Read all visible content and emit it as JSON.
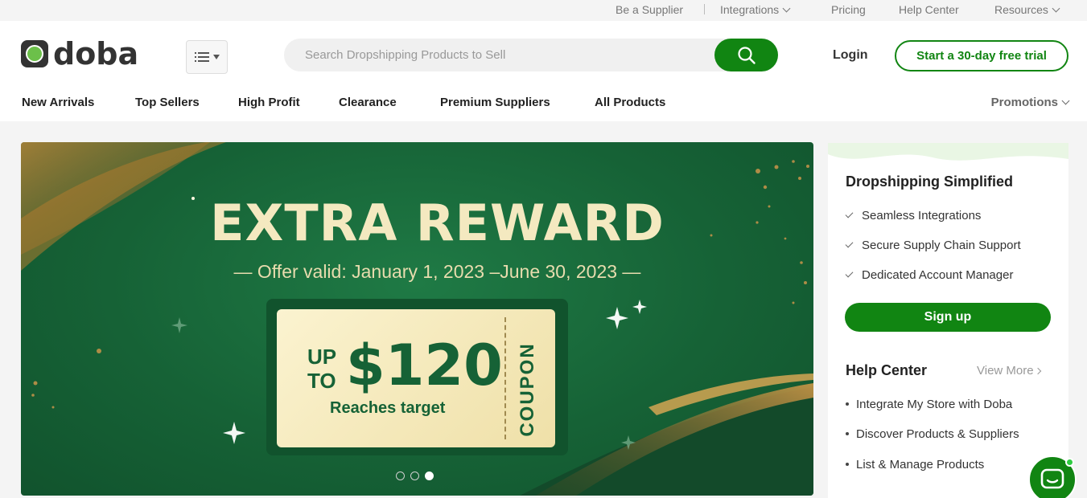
{
  "utility_bar": {
    "supplier": "Be a Supplier",
    "integrations": "Integrations",
    "pricing": "Pricing",
    "help_center": "Help Center",
    "resources": "Resources"
  },
  "header": {
    "logo_text": "doba",
    "search_placeholder": "Search Dropshipping Products to Sell",
    "login": "Login",
    "trial": "Start a 30-day free trial"
  },
  "nav": {
    "items": [
      "New Arrivals",
      "Top Sellers",
      "High Profit",
      "Clearance",
      "Premium Suppliers",
      "All Products"
    ],
    "promotions": "Promotions"
  },
  "banner": {
    "title": "EXTRA REWARD",
    "subtitle": "— Offer valid: January 1, 2023 –June 30, 2023 —",
    "coupon_up": "UP",
    "coupon_to": "TO",
    "coupon_amount": "$120",
    "coupon_target": "Reaches target",
    "coupon_label": "COUPON",
    "active_slide": 3,
    "slide_count": 3
  },
  "side_panel": {
    "title": "Dropshipping Simplified",
    "features": [
      "Seamless Integrations",
      "Secure Supply Chain Support",
      "Dedicated Account Manager"
    ],
    "signup": "Sign up",
    "help_title": "Help Center",
    "view_more": "View More",
    "help_links": [
      "Integrate My Store with Doba",
      "Discover Products & Suppliers",
      "List & Manage Products"
    ]
  },
  "colors": {
    "brand_green": "#118512",
    "banner_green": "#166236",
    "gold": "#f4e9c0"
  },
  "icons": {
    "search": "search-icon",
    "categories": "list-icon",
    "chat": "chat-icon"
  }
}
